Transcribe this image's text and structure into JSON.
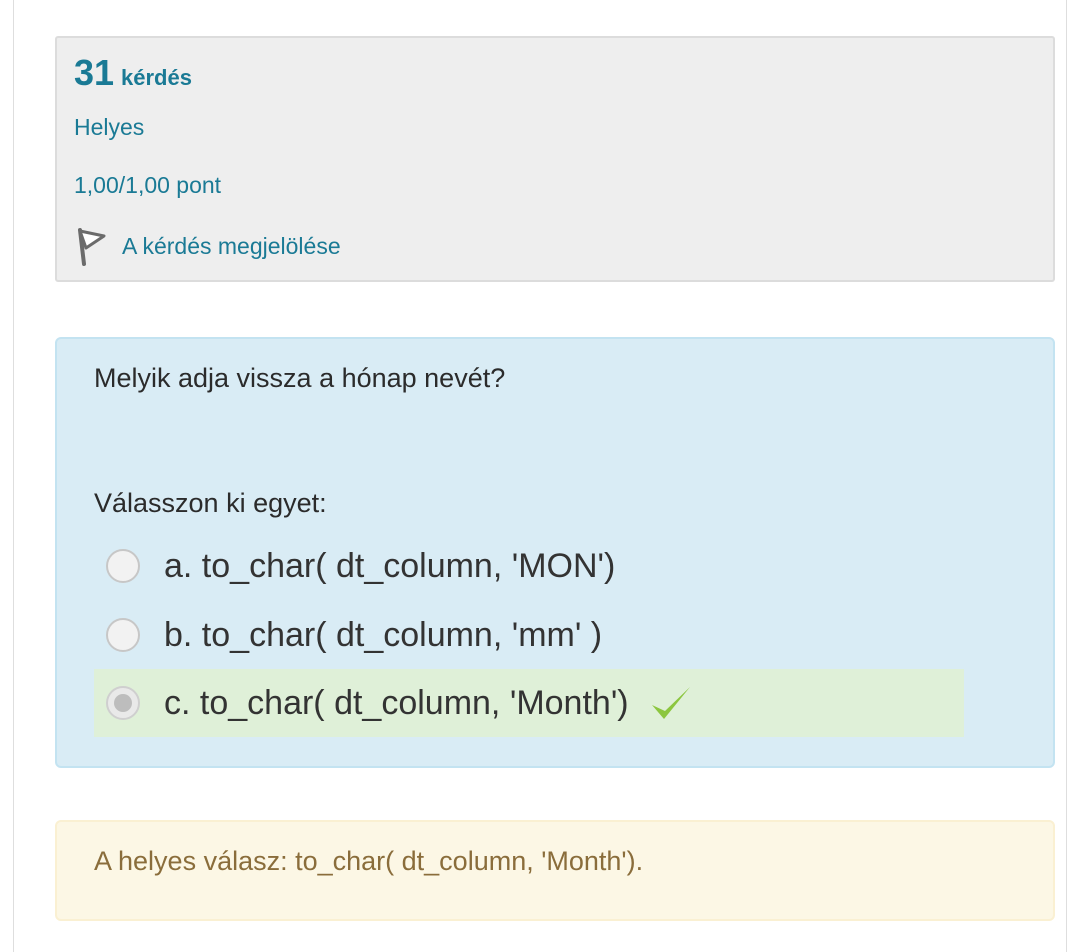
{
  "info": {
    "question_number": "31",
    "question_word": "kérdés",
    "state": "Helyes",
    "grade": "1,00/1,00 pont",
    "flag_label": "A kérdés megjelölése",
    "flag_icon": "flag-icon"
  },
  "question": {
    "text": "Melyik adja vissza a hónap nevét?",
    "prompt": "Válasszon ki egyet:",
    "options": [
      {
        "label": "a. to_char( dt_column, 'MON')",
        "selected": false,
        "correct": false
      },
      {
        "label": "b. to_char( dt_column, 'mm' )",
        "selected": false,
        "correct": false
      },
      {
        "label": "c. to_char( dt_column, 'Month')",
        "selected": true,
        "correct": true
      }
    ],
    "correct_icon": "check-icon"
  },
  "feedback": {
    "right_answer": "A helyes válasz: to_char( dt_column, 'Month')."
  },
  "colors": {
    "accent": "#1a7a95",
    "info_bg": "#eeeeee",
    "question_bg": "#d9ecf5",
    "correct_bg": "#dff0d8",
    "check_green": "#8cc63f",
    "feedback_bg": "#fcf7e5",
    "feedback_text": "#8a6d3b"
  }
}
